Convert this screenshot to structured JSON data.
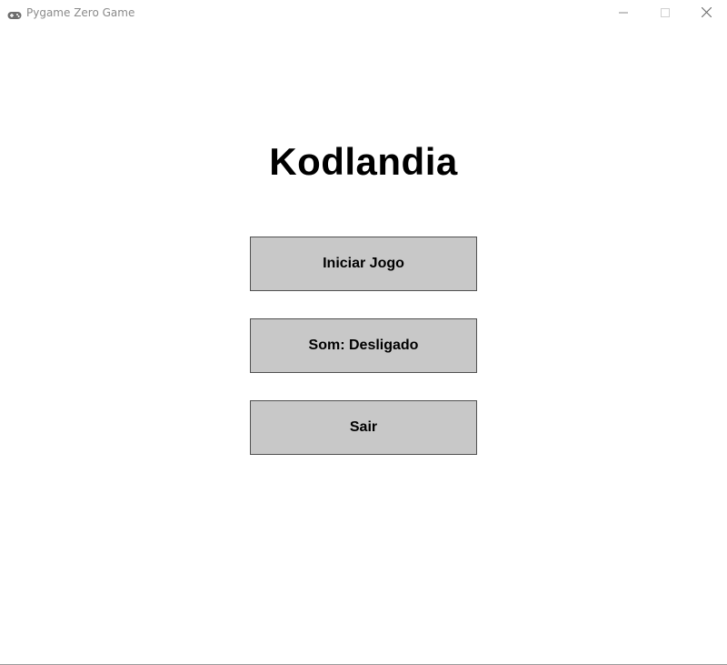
{
  "window": {
    "title": "Pygame Zero Game",
    "icon": "gamepad-icon",
    "controls": {
      "minimize_icon": "minimize-icon",
      "maximize_icon": "maximize-icon",
      "close_icon": "close-icon"
    }
  },
  "menu": {
    "title": "Kodlandia",
    "buttons": [
      {
        "label": "Iniciar Jogo"
      },
      {
        "label": "Som: Desligado"
      },
      {
        "label": "Sair"
      }
    ]
  },
  "colors": {
    "background": "#ffffff",
    "button_fill": "#c8c8c8",
    "button_border": "#505050",
    "text": "#000000",
    "titlebar_text": "#8a8a8a"
  }
}
